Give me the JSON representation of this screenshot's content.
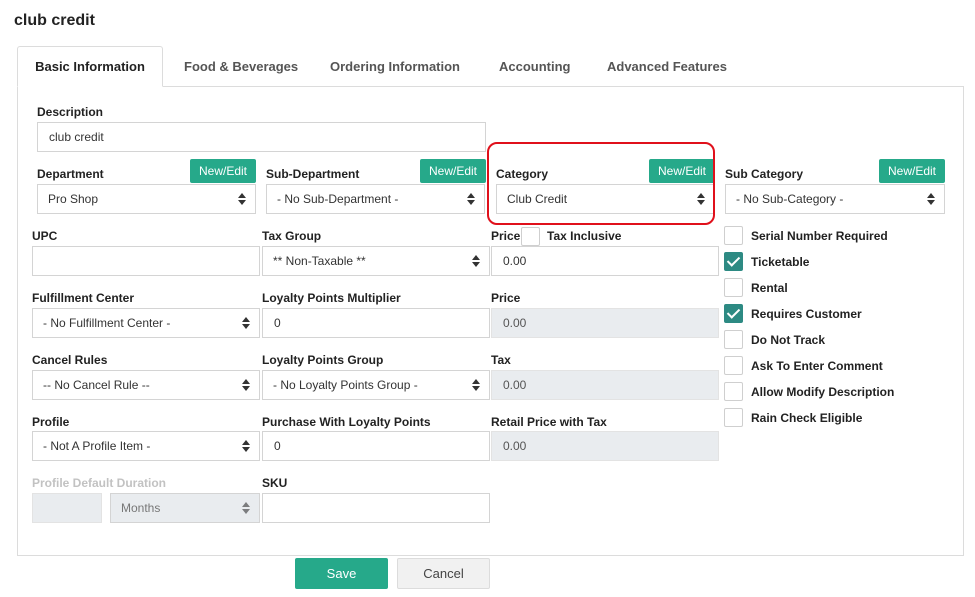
{
  "page": {
    "title": "club credit"
  },
  "tabs": [
    {
      "label": "Basic Information"
    },
    {
      "label": "Food & Beverages"
    },
    {
      "label": "Ordering Information"
    },
    {
      "label": "Accounting"
    },
    {
      "label": "Advanced Features"
    }
  ],
  "form": {
    "description": {
      "label": "Description",
      "value": "club credit"
    },
    "new_edit_label": "New/Edit",
    "department": {
      "label": "Department",
      "value": "Pro Shop"
    },
    "sub_department": {
      "label": "Sub-Department",
      "value": "- No Sub-Department -"
    },
    "category": {
      "label": "Category",
      "value": "Club Credit"
    },
    "sub_category": {
      "label": "Sub Category",
      "value": "- No Sub-Category -"
    },
    "upc": {
      "label": "UPC",
      "value": ""
    },
    "tax_group": {
      "label": "Tax Group",
      "value": "** Non-Taxable **"
    },
    "price": {
      "label": "Price",
      "value": "0.00"
    },
    "tax_inclusive": {
      "label": "Tax Inclusive",
      "checked": false
    },
    "fulfillment_center": {
      "label": "Fulfillment Center",
      "value": "- No Fulfillment Center -"
    },
    "loyalty_multiplier": {
      "label": "Loyalty Points Multiplier",
      "value": "0"
    },
    "price_readonly": {
      "label": "Price",
      "value": "0.00"
    },
    "cancel_rules": {
      "label": "Cancel Rules",
      "value": "-- No Cancel Rule --"
    },
    "loyalty_group": {
      "label": "Loyalty Points Group",
      "value": "- No Loyalty Points Group -"
    },
    "tax": {
      "label": "Tax",
      "value": "0.00"
    },
    "profile": {
      "label": "Profile",
      "value": "- Not A Profile Item -"
    },
    "purchase_loyalty": {
      "label": "Purchase With Loyalty Points",
      "value": "0"
    },
    "retail_price_tax": {
      "label": "Retail Price with Tax",
      "value": "0.00"
    },
    "profile_default_duration": {
      "label": "Profile Default Duration",
      "value": "",
      "unit": "Months"
    },
    "sku": {
      "label": "SKU",
      "value": ""
    }
  },
  "options": [
    {
      "label": "Serial Number Required",
      "checked": false
    },
    {
      "label": "Ticketable",
      "checked": true
    },
    {
      "label": "Rental",
      "checked": false
    },
    {
      "label": "Requires Customer",
      "checked": true
    },
    {
      "label": "Do Not Track",
      "checked": false
    },
    {
      "label": "Ask To Enter Comment",
      "checked": false
    },
    {
      "label": "Allow Modify Description",
      "checked": false
    },
    {
      "label": "Rain Check Eligible",
      "checked": false
    }
  ],
  "actions": {
    "save": "Save",
    "cancel": "Cancel"
  },
  "colors": {
    "accent": "#26a98a",
    "check": "#2d8a83",
    "highlight": "#e0101b"
  }
}
